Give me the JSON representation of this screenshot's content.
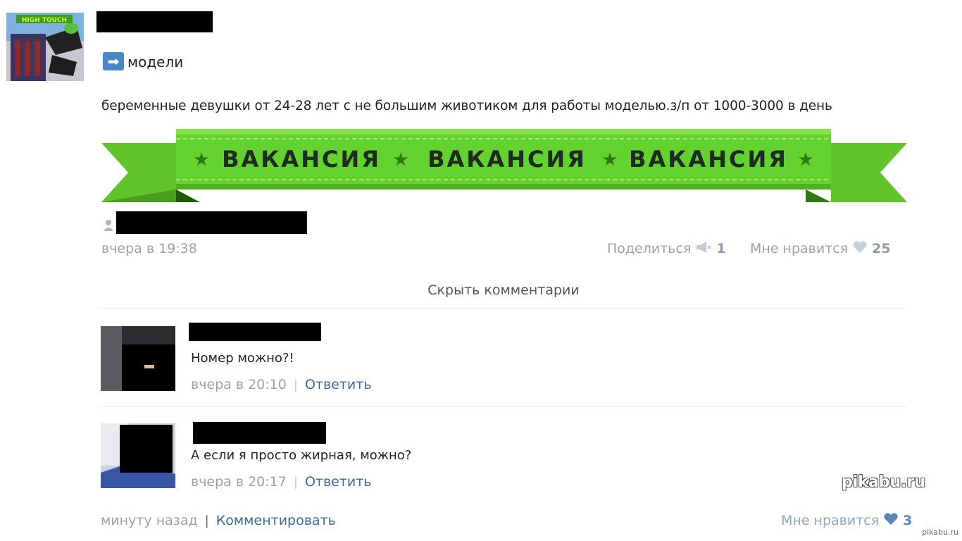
{
  "post": {
    "source_label": "модели",
    "text": "беременные девушки от 24-28 лет с не большим животиком для работы моделью.з/п от 1000-3000 в день",
    "banner_words": [
      "ВАКАНСИЯ",
      "ВАКАНСИЯ",
      "ВАКАНСИЯ"
    ],
    "timestamp": "вчера в 19:38",
    "share_label": "Поделиться",
    "share_count": "1",
    "like_label": "Мне нравится",
    "like_count": "25",
    "avatar_text": "HIGH TOUCH"
  },
  "hide_comments_label": "Скрыть комментарии",
  "comments": [
    {
      "text": "Номер можно?!",
      "time": "вчера в 20:10",
      "sep": "|",
      "reply": "Ответить"
    },
    {
      "text": "А если я просто жирная, можно?",
      "time": "вчера в 20:17",
      "sep": "|",
      "reply": "Ответить"
    }
  ],
  "footer": {
    "time": "минуту назад",
    "sep": "|",
    "comment_label": "Комментировать",
    "like_label": "Мне нравится",
    "like_count": "3"
  },
  "watermark": "pikabu.ru",
  "corner_watermark": "pikabu.ru",
  "colors": {
    "banner_green": "#5cc92c",
    "link": "#3d6a99",
    "meta": "#9aa3ad"
  },
  "icons": [
    "arrow-right-icon",
    "person-icon",
    "megaphone-icon",
    "heart-icon"
  ]
}
